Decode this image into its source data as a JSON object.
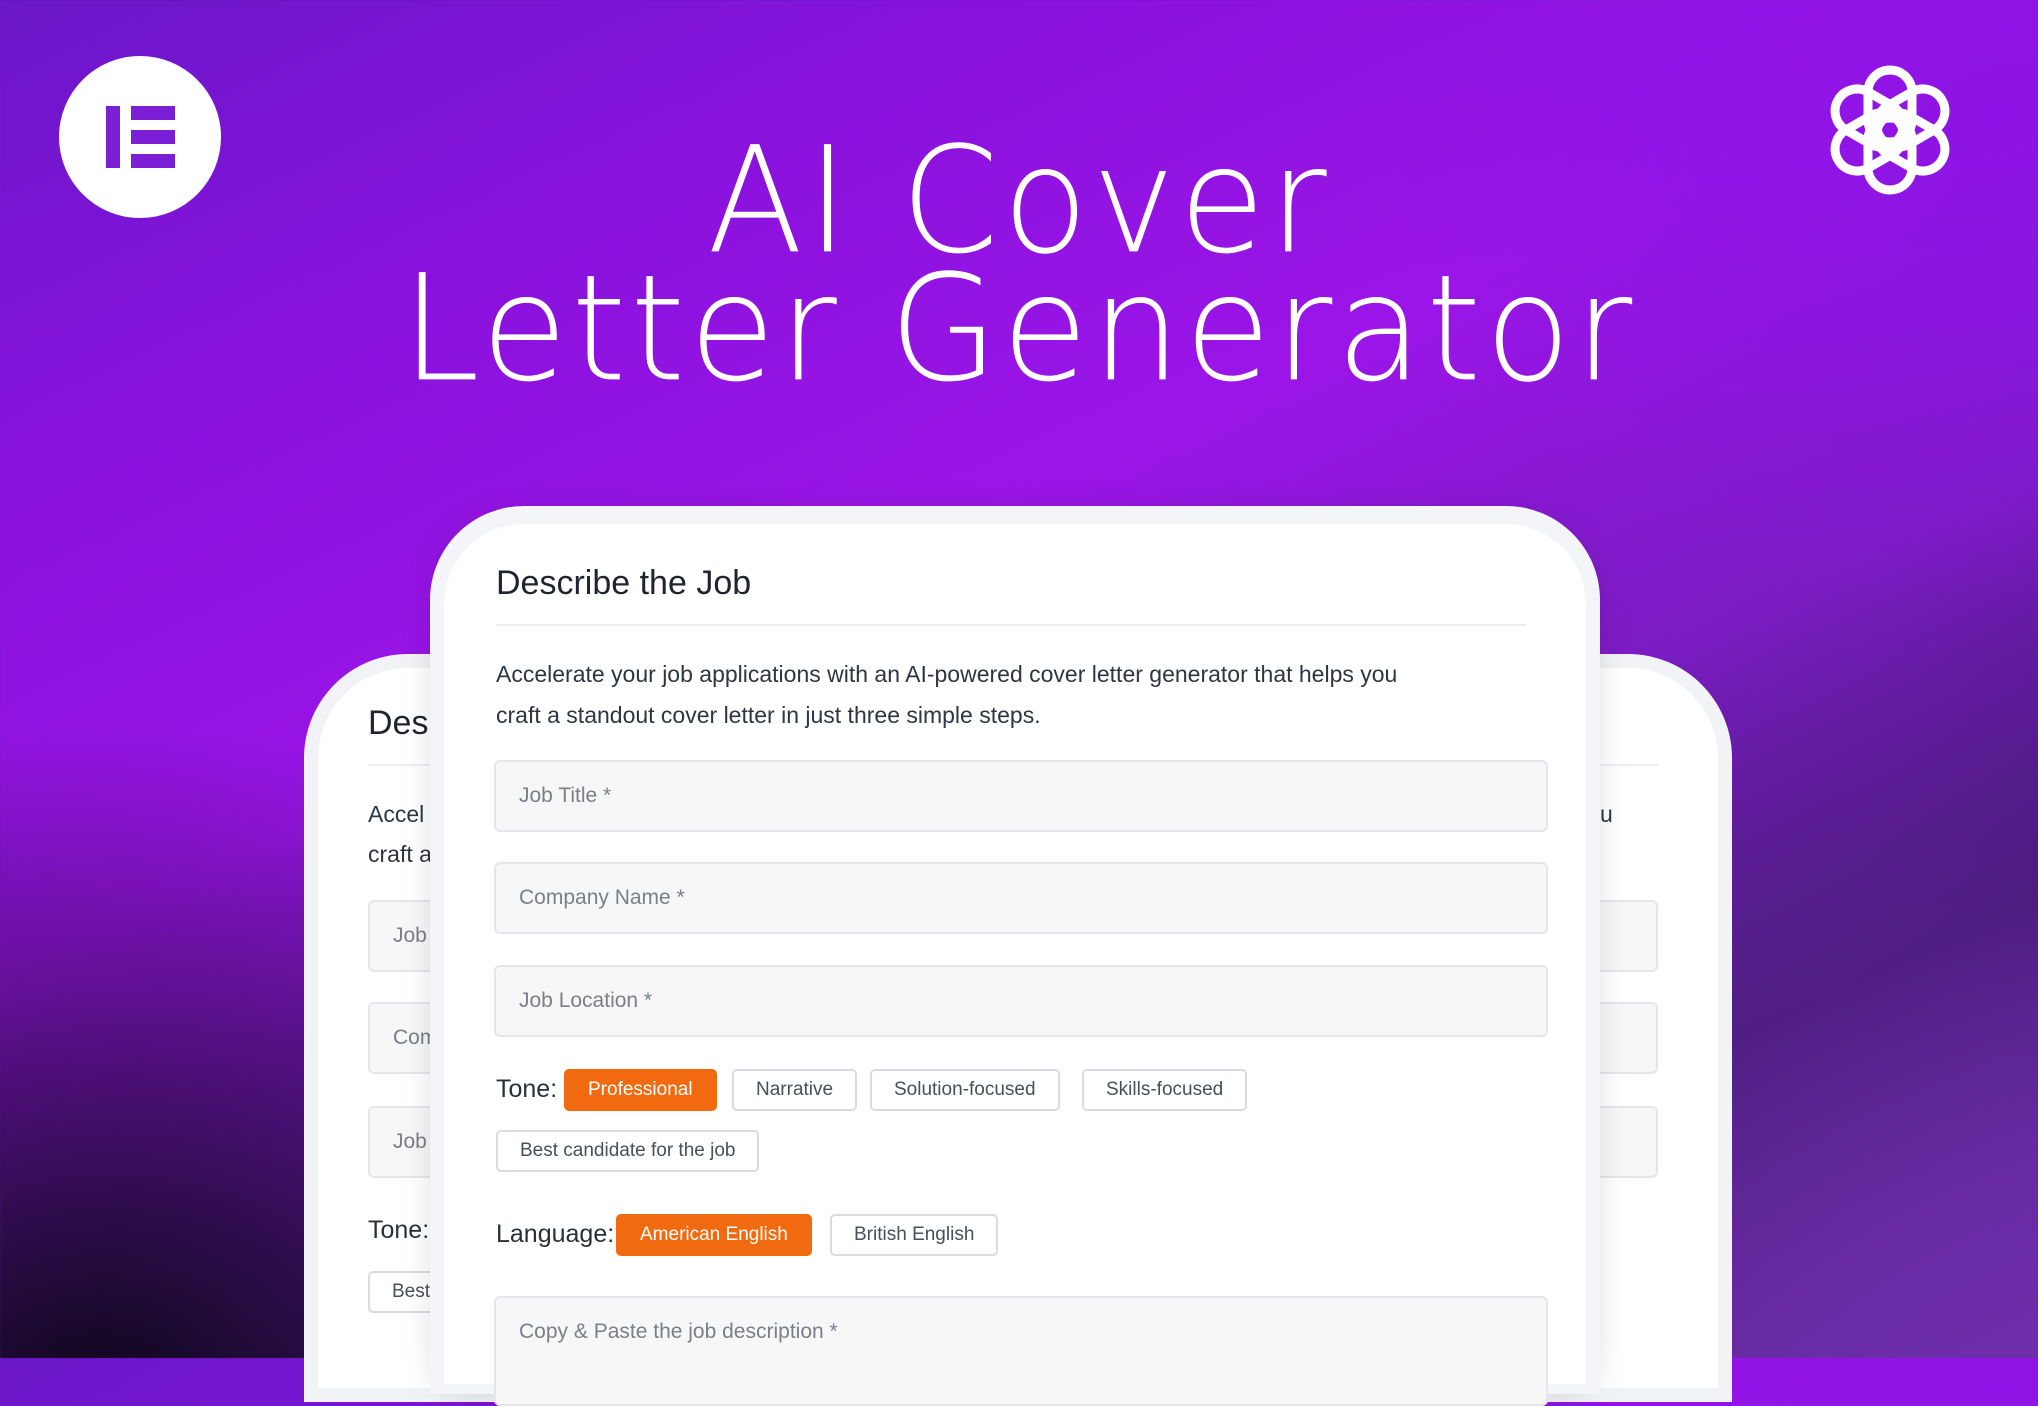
{
  "headline": {
    "line1": "AI Cover",
    "line2": "Letter Generator"
  },
  "logos": {
    "left_icon": "elementor-logo",
    "right_icon": "openai-logo"
  },
  "form": {
    "title": "Describe the Job",
    "description_line1": "Accelerate your job applications with an AI-powered cover letter generator that helps you",
    "description_line2": "craft a standout cover letter in just three simple steps.",
    "fields": {
      "job_title": "Job Title *",
      "company_name": "Company Name *",
      "job_location": "Job Location *",
      "job_description": "Copy & Paste the job description *"
    },
    "tone": {
      "label": "Tone:",
      "options": [
        "Professional",
        "Narrative",
        "Solution-focused",
        "Skills-focused",
        "Best candidate for the job"
      ],
      "selected": "Professional"
    },
    "language": {
      "label": "Language:",
      "options": [
        "American English",
        "British English"
      ],
      "selected": "American English"
    }
  },
  "back_card": {
    "title_fragment": "Des",
    "desc_fragment_1": "Accel",
    "desc_fragment_2": "craft a",
    "desc_fragment_right": "u",
    "field_fragment_1": "Job",
    "field_fragment_2": "Com",
    "field_fragment_3": "Job",
    "tone_label": "Tone:",
    "chip_fragment": "Best"
  },
  "colors": {
    "accent": "#f26a0f",
    "brand_purple": "#7a1fd6",
    "background_purple": "#8a12dd"
  }
}
